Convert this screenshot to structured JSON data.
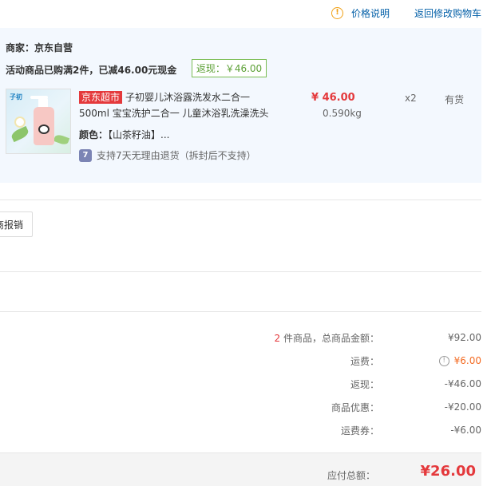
{
  "header": {
    "price_help_label": "价格说明",
    "return_cart_label": "返回修改购物车"
  },
  "shop": {
    "seller": "商家：京东自营",
    "promo_text": "活动商品已购满2件，已减46.00元现金",
    "rebate_badge": "返现：￥46.00",
    "item": {
      "thumb_brand": "子初",
      "tag": "京东超市",
      "title_line1": "子初婴儿沐浴露洗发水二合一",
      "title_line2": "500ml 宝宝洗护二合一 儿童沐浴乳洗澡洗头",
      "color_label": "颜色：",
      "color_value": "【山茶籽油】...",
      "support_icon": "7",
      "support_text": "支持7天无理由退货（拆封后不支持）",
      "price": "¥ 46.00",
      "weight": "0.590kg",
      "quantity": "x2",
      "stock": "有货"
    }
  },
  "report_button": "商报销",
  "summary": {
    "count": "2",
    "count_suffix": " 件商品，总商品金额：",
    "total_goods": "¥92.00",
    "shipping_label": "运费：",
    "shipping_value": "¥6.00",
    "rebate_label": "返现：",
    "rebate_value": "-¥46.00",
    "discount_label": "商品优惠：",
    "discount_value": "-¥20.00",
    "coupon_label": "运费券：",
    "coupon_value": "-¥6.00"
  },
  "total": {
    "label": "应付总额：",
    "value": "¥26.00"
  },
  "icons": {
    "info": "info-circle-icon",
    "support": "return-support-icon"
  },
  "colors": {
    "accent_red": "#e4393c",
    "link_blue": "#005ea7",
    "panel_bg": "#f3f8fe",
    "rebate_green": "#5ca036",
    "shipping_orange": "#f36a21"
  }
}
